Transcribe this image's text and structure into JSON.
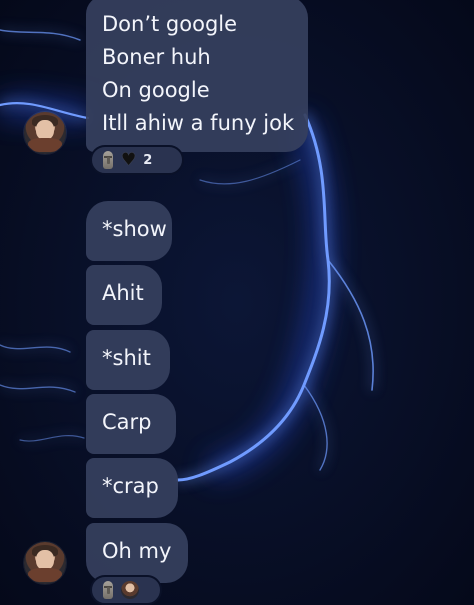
{
  "messages": [
    {
      "lines": [
        "Don’t google",
        "Boner huh",
        "On google",
        "Itll ahiw a funy jok"
      ]
    },
    {
      "text": "*show"
    },
    {
      "text": "Ahit"
    },
    {
      "text": "*shit"
    },
    {
      "text": "Carp"
    },
    {
      "text": "*crap"
    },
    {
      "text": "Oh my"
    }
  ],
  "reactions": [
    {
      "items": [
        "moai-emoji-icon",
        "black-heart-icon"
      ],
      "count": "2"
    },
    {
      "items": [
        "moai-emoji-icon",
        "reactor-avatar"
      ]
    }
  ],
  "colors": {
    "background": "#070d22",
    "bubble": "#36405e",
    "text": "#f3f5fb",
    "glow": "#3a6dff"
  }
}
